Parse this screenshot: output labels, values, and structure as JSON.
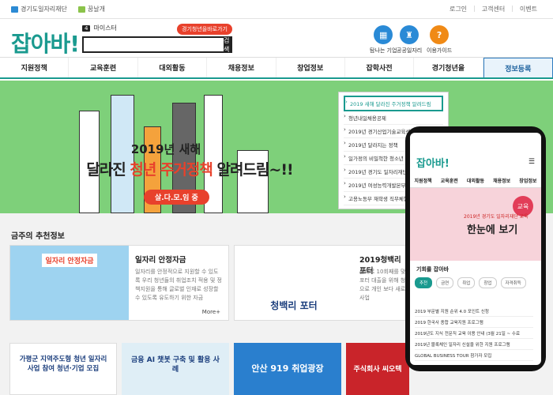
{
  "topbar": {
    "left": [
      "경기도일자리재단",
      "꿈날개"
    ],
    "right": [
      "로그인",
      "고객센터",
      "이벤트"
    ]
  },
  "logo": "잡아바!",
  "my": {
    "num": "4",
    "label": "마이스터"
  },
  "badge": "경기청년을바로가기",
  "search": {
    "button": "검색"
  },
  "quick": [
    {
      "label": "탐나는 기업",
      "color": "#2a8ad6",
      "glyph": "▦"
    },
    {
      "label": "공공일자리",
      "color": "#2a8ad6",
      "glyph": "♜"
    },
    {
      "label": "이용가이드",
      "color": "#f08a16",
      "glyph": "?"
    }
  ],
  "nav": [
    "지원정책",
    "교육훈련",
    "대외활동",
    "채용정보",
    "창업정보",
    "잡학사전",
    "경기청년을",
    "정보등록"
  ],
  "banner": {
    "line1": "2019년 새해",
    "line2a": "달라진 ",
    "line2b": "청년 주거정책",
    "line2c": " 알려드림~!!",
    "button": "살.다.모.임 중",
    "list": [
      "2019 새해 달라진 주거정책 알려드림",
      "청년내일채용공제",
      "2019년 경기산업기술교육센터 취업교육생 모집",
      "2019년 달라지는 정책",
      "일가정의 비밀척한 청소년 노동인권",
      "2019년 경기도 일자리재단 채용",
      "2019년 여성능력개발본부 위탁기관",
      "고용노동부 재학생 직무체험"
    ]
  },
  "section_title": "금주의 추천정보",
  "cards": [
    {
      "title": "일자리 안정자금",
      "desc": "일자리를 안정적으로 지원할 수 있도록 우리 청년들의 취업조치 적용 및 정책지원을 통해 글로벌 인재로 성장할 수 있도록 유도하기 위한 자금",
      "more": "More+",
      "img_text": "일자리 안정자금"
    },
    {
      "title": "2019청백리포터",
      "desc": "올해로 10회째를 맞이하는 청백리 리포터 대출을 위해 청년들의 많은 이용으로 개인 보다 새로운 발굴하기 위한 사업",
      "more": "",
      "img_text": "청백리 포터"
    }
  ],
  "tiles": [
    {
      "text": "가평군 지역주도형 청년 일자리 사업 참여 청년·기업 모집",
      "bg": "#ffffff"
    },
    {
      "text": "금융 AI 챗봇 구축 및 활용 사례",
      "bg": "#dfeef6"
    },
    {
      "text": "안산 919 취업광장",
      "bg": "#2a7fce"
    },
    {
      "text": "주식회사 씨오텍",
      "bg": "#c9242a"
    }
  ],
  "phone": {
    "logo": "잡아바!",
    "nav": [
      "지원정책",
      "교육훈련",
      "대외활동",
      "채용정보",
      "창업정보"
    ],
    "t1": "2019년 경기도 일자리재단 교육",
    "t2": "한눈에 보기",
    "circle": "교육",
    "label": "기회를 잡아바",
    "chips": [
      "추천",
      "금연",
      "취업",
      "창업",
      "자격취득"
    ],
    "list": [
      "2019 부문별 지원 순위 4.0 포인트 신청",
      "2019 한국사 종합 교육지원 프로그램",
      "2019년도 지식 전문직 교육 이용 안내 (3월 21일 ~ 수료",
      "2019년 블록체인 일자리 신설을 위한 지원 프로그램",
      "GLOBAL BUSINESS TOUR 참가자 모집"
    ]
  }
}
